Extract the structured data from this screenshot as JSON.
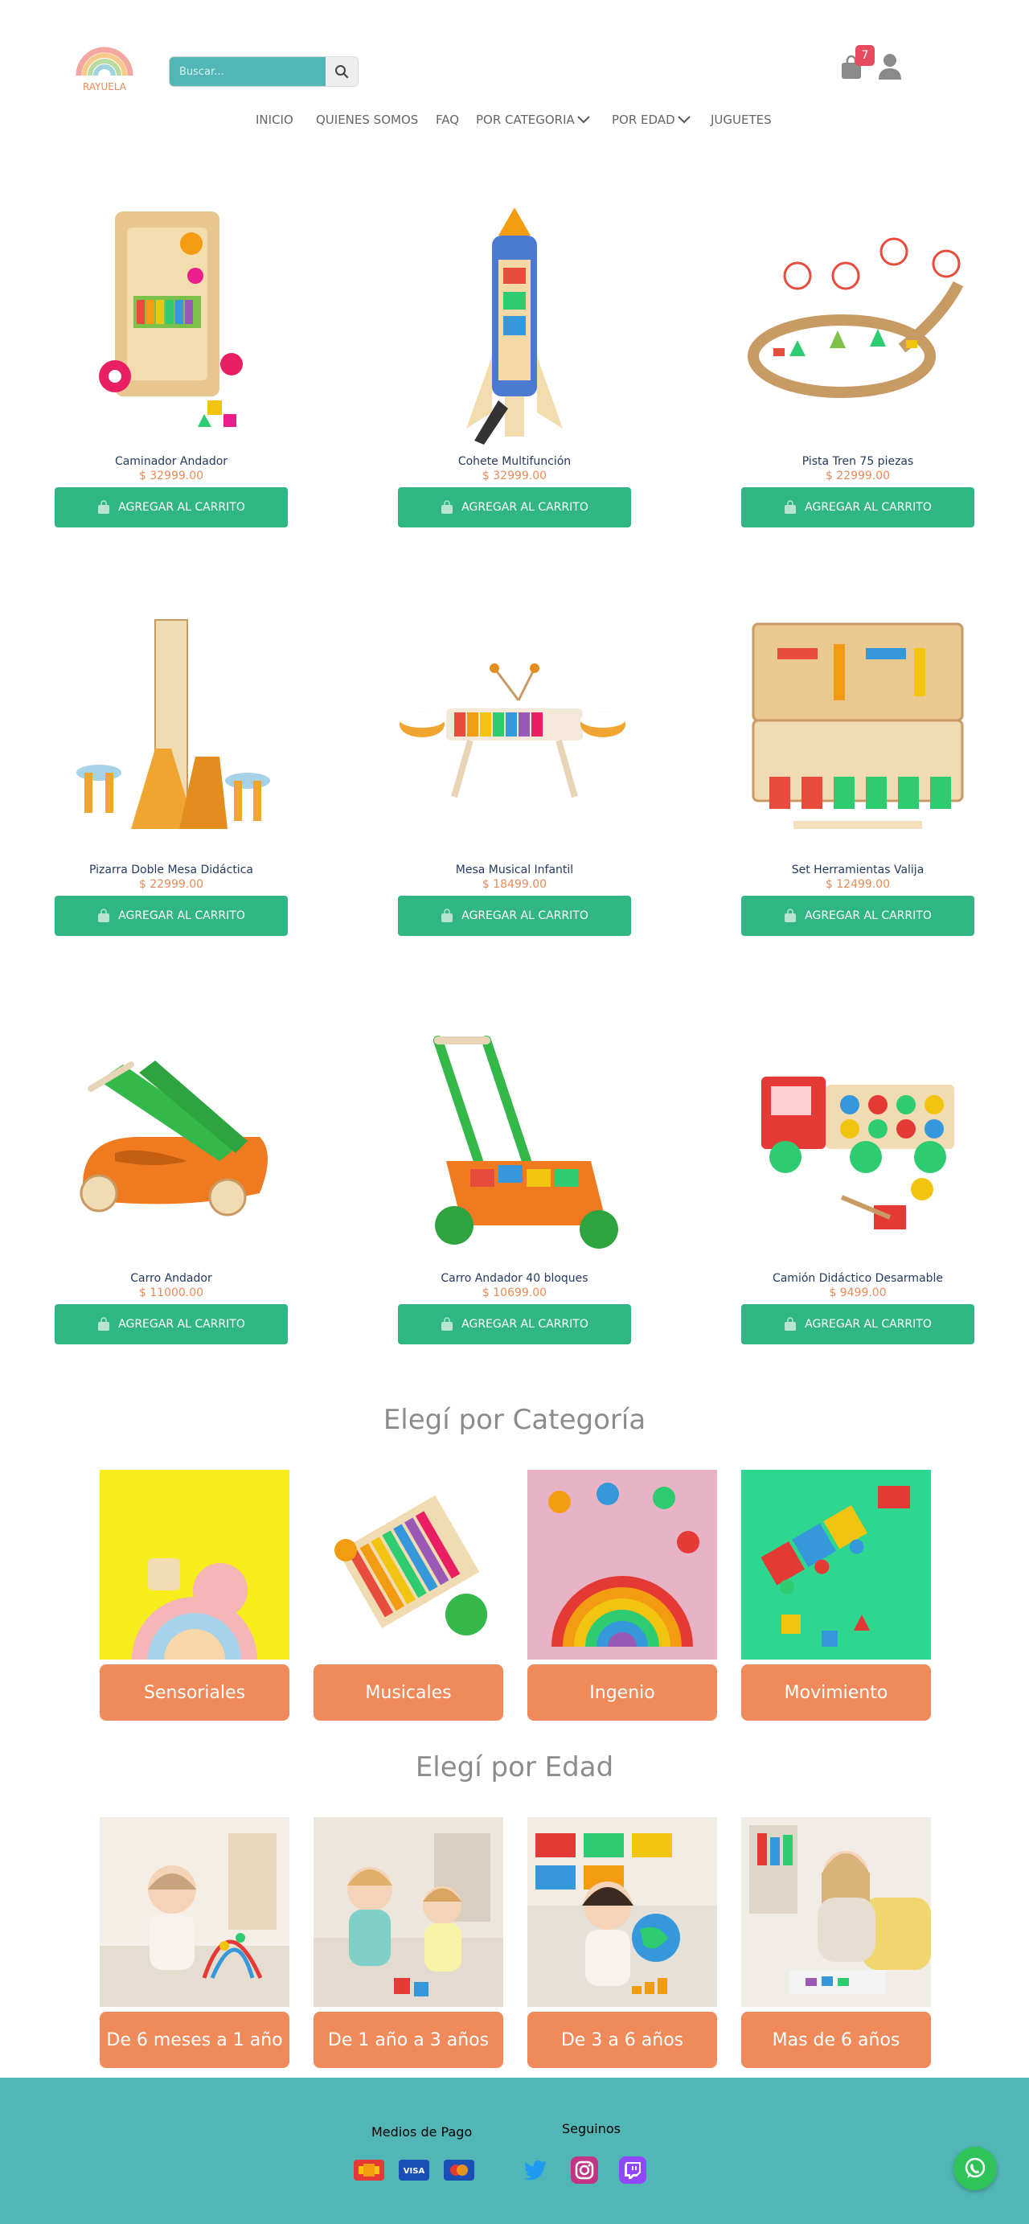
{
  "header": {
    "logo_text": "RAYUELA",
    "search_placeholder": "Buscar...",
    "cart_count": "7",
    "nav": [
      {
        "label": "INICIO"
      },
      {
        "label": "QUIENES SOMOS"
      },
      {
        "label": "FAQ"
      },
      {
        "label": "POR CATEGORIA"
      },
      {
        "label": "POR EDAD"
      },
      {
        "label": "JUGUETES"
      }
    ]
  },
  "products": [
    {
      "name": "Caminador Andador",
      "price": "$ 32999.00",
      "button": "AGREGAR AL CARRITO",
      "icon": "walker-toy-image"
    },
    {
      "name": "Cohete Multifunción",
      "price": "$ 32999.00",
      "button": "AGREGAR AL CARRITO",
      "icon": "rocket-toy-image"
    },
    {
      "name": "Pista Tren 75 piezas",
      "price": "$ 22999.00",
      "button": "AGREGAR AL CARRITO",
      "icon": "train-track-image"
    },
    {
      "name": "Pizarra Doble Mesa Didáctica",
      "price": "$ 22999.00",
      "button": "AGREGAR AL CARRITO",
      "icon": "easel-table-image"
    },
    {
      "name": "Mesa Musical Infantil",
      "price": "$ 18499.00",
      "button": "AGREGAR AL CARRITO",
      "icon": "musical-table-image"
    },
    {
      "name": "Set Herramientas Valija",
      "price": "$ 12499.00",
      "button": "AGREGAR AL CARRITO",
      "icon": "tool-case-image"
    },
    {
      "name": "Carro Andador",
      "price": "$ 11000.00",
      "button": "AGREGAR AL CARRITO",
      "icon": "push-car-image"
    },
    {
      "name": "Carro Andador 40 bloques",
      "price": "$ 10699.00",
      "button": "AGREGAR AL CARRITO",
      "icon": "block-cart-image"
    },
    {
      "name": "Camión Didáctico Desarmable",
      "price": "$ 9499.00",
      "button": "AGREGAR AL CARRITO",
      "icon": "truck-toy-image"
    }
  ],
  "categories_section": {
    "title": "Elegí por Categoría",
    "items": [
      {
        "label": "Sensoriales",
        "bg": "#f7ec1c"
      },
      {
        "label": "Musicales",
        "bg": "#ffffff"
      },
      {
        "label": "Ingenio",
        "bg": "#e8b3c4"
      },
      {
        "label": "Movimiento",
        "bg": "#2fd68f"
      }
    ]
  },
  "ages_section": {
    "title": "Elegí por Edad",
    "items": [
      {
        "label": "De 6 meses a 1 año"
      },
      {
        "label": "De 1 año a 3 años"
      },
      {
        "label": "De 3 a 6 años"
      },
      {
        "label": "Mas de 6 años"
      }
    ]
  },
  "footer": {
    "payments_title": "Medios de Pago",
    "social_title": "Seguinos",
    "payments": [
      "mercadopago-icon",
      "visa-icon",
      "mastercard-icon"
    ],
    "social": [
      "twitter-icon",
      "instagram-icon",
      "twitch-icon"
    ]
  },
  "colors": {
    "accent_green": "#2fb683",
    "teal": "#53b6b6",
    "orange": "#f08a5a",
    "price": "#e58b5a",
    "badge": "#e84a5f"
  }
}
